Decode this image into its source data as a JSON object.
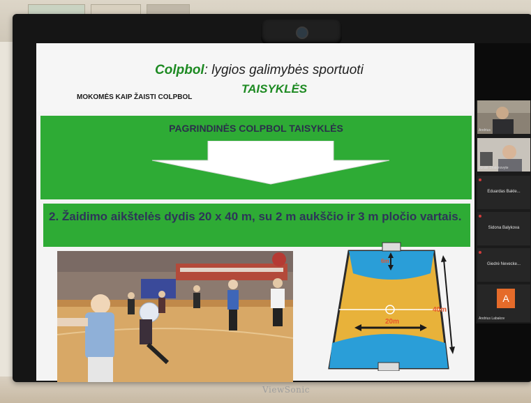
{
  "slide": {
    "title_brand": "Colpbol",
    "title_rest": ": lygios galimybės sportuoti",
    "subtitle": "TAISYKLĖS",
    "small_heading": "MOKOMĖS KAIP ŽAISTI COLPBOL",
    "band1_title": "PAGRINDINĖS COLPBOL TAISYKLĖS",
    "rule_text": "2. Žaidimo aikštelės dydis 20 x 40 m, su 2 m aukščio ir 3 m pločio vartais.",
    "court": {
      "label_goal_area": "6m",
      "label_width": "20m",
      "label_length": "40m"
    }
  },
  "participants": [
    {
      "name": "Andrius",
      "type": "video"
    },
    {
      "name": "Jūratė Sriakinovyte",
      "type": "video"
    },
    {
      "name": "Eduardas Bakle...",
      "type": "name"
    },
    {
      "name": "Sidona Balykova",
      "type": "name"
    },
    {
      "name": "Giedrė Nevecke...",
      "type": "name"
    },
    {
      "name": "Andrius Labakov",
      "type": "avatar",
      "initial": "A"
    }
  ],
  "monitor": {
    "brand": "ViewSonic"
  },
  "colors": {
    "slide_green": "#2eab35",
    "title_green": "#1d8a22",
    "avatar_orange": "#e56b2a"
  }
}
